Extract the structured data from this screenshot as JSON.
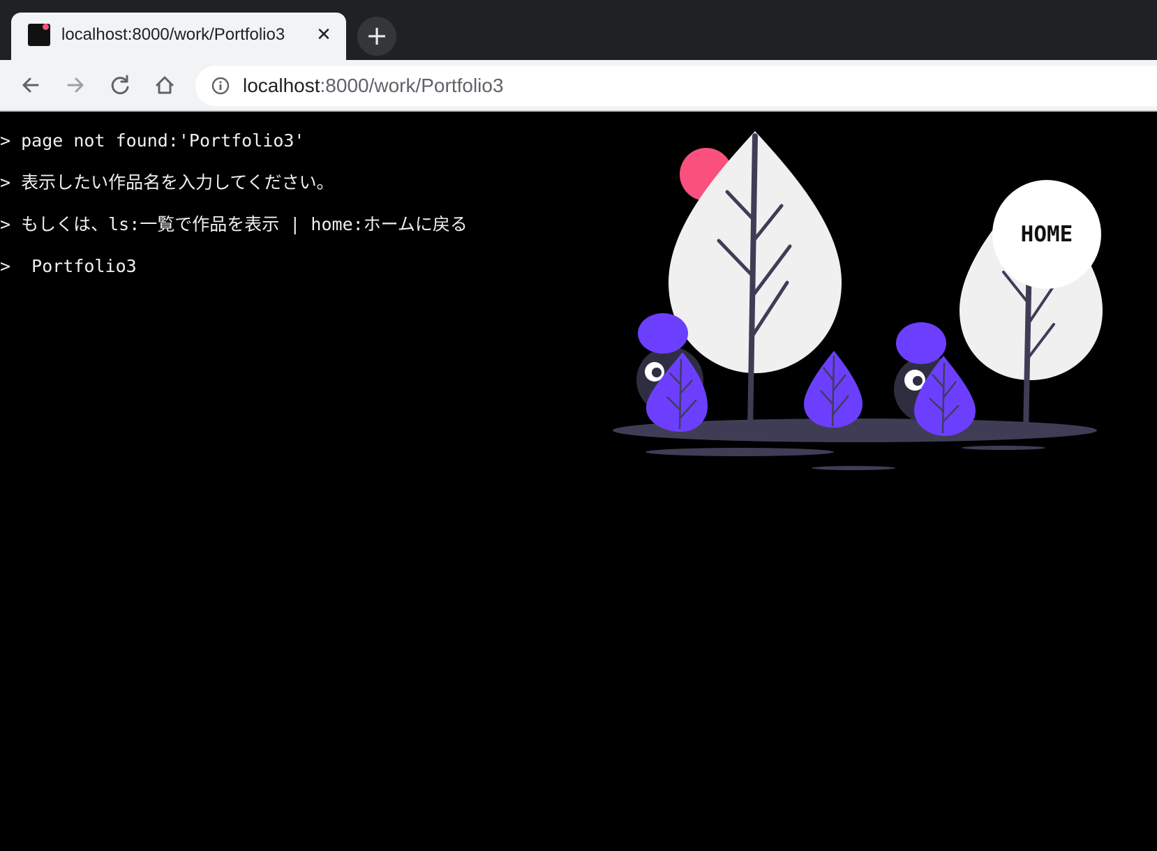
{
  "browser": {
    "tab": {
      "title": "localhost:8000/work/Portfolio3",
      "close_icon": "close-icon"
    },
    "new_tab_icon": "plus-icon",
    "toolbar": {
      "back_icon": "arrow-left-icon",
      "forward_icon": "arrow-right-icon",
      "reload_icon": "reload-icon",
      "home_icon": "home-icon"
    },
    "address_bar": {
      "info_icon": "info-icon",
      "url_host": "localhost",
      "url_path": ":8000/work/Portfolio3"
    }
  },
  "terminal": {
    "lines": [
      "> page not found:'Portfolio3'",
      "> 表示したい作品名を入力してください。",
      "> もしくは、ls:一覧で作品を表示 | home:ホームに戻る",
      ">  Portfolio3"
    ]
  },
  "home_button": {
    "label": "HOME"
  },
  "colors": {
    "background": "#000000",
    "leaf_white": "#f0f0f0",
    "leaf_purple": "#6c3fff",
    "trunk": "#3f3d56",
    "sun_pink": "#f9507e",
    "ground": "#3f3d56"
  }
}
